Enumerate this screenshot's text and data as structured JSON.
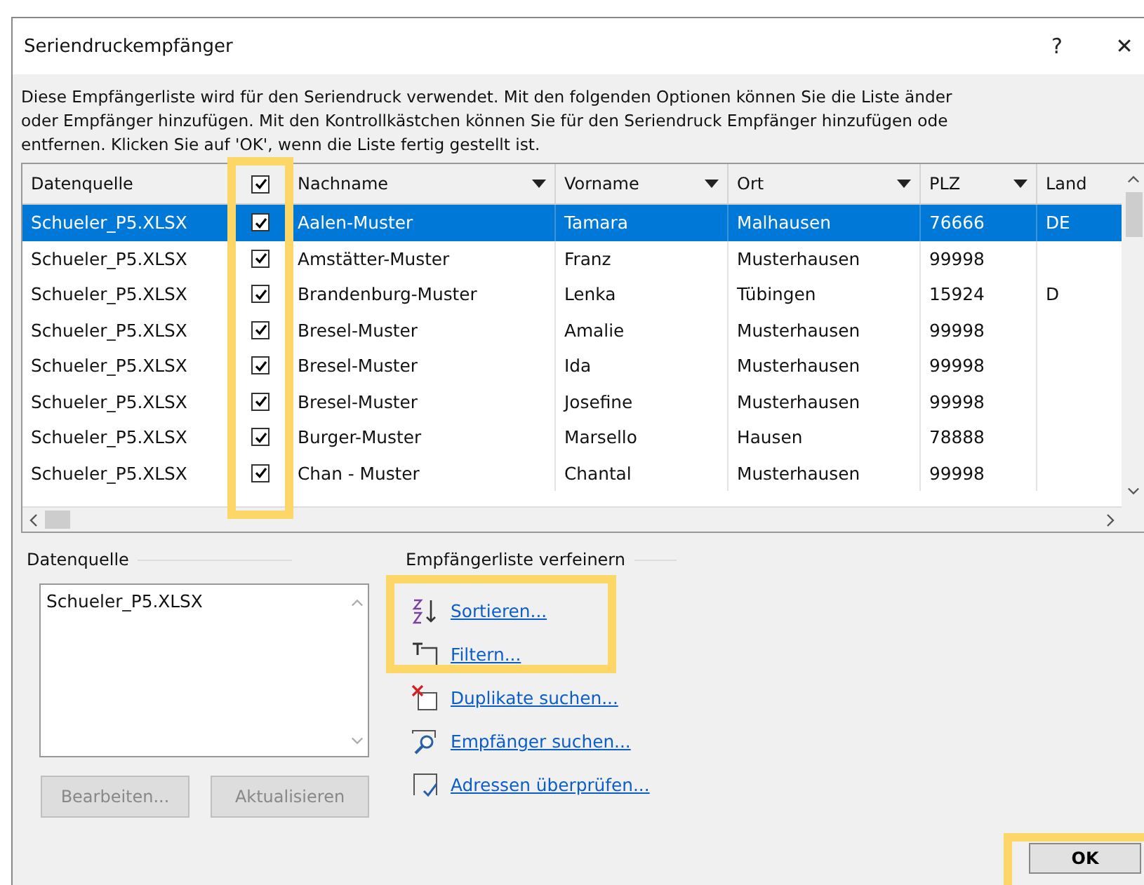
{
  "window": {
    "title": "Seriendruckempfänger",
    "help": "?",
    "close": "✕"
  },
  "intro": [
    "Diese Empfängerliste wird für den Seriendruck verwendet. Mit den folgenden Optionen können Sie die Liste änder",
    "oder Empfänger hinzufügen. Mit den Kontrollkästchen können Sie für den Seriendruck Empfänger hinzufügen ode",
    "entfernen. Klicken Sie auf 'OK', wenn die Liste fertig gestellt ist."
  ],
  "table": {
    "select_all_checked": true,
    "columns": [
      {
        "label": "Datenquelle",
        "kind": "plain"
      },
      {
        "label": "Nachname",
        "kind": "dropdown"
      },
      {
        "label": "Vorname",
        "kind": "dropdown"
      },
      {
        "label": "Ort",
        "kind": "dropdown"
      },
      {
        "label": "PLZ",
        "kind": "dropdown"
      },
      {
        "label": "Land",
        "kind": "plain"
      }
    ],
    "rows": [
      {
        "checked": true,
        "cells": [
          "Schueler_P5.XLSX",
          "Aalen-Muster",
          "Tamara",
          "Malhausen",
          "76666",
          "DE"
        ],
        "selected": true
      },
      {
        "checked": true,
        "cells": [
          "Schueler_P5.XLSX",
          "Amstätter-Muster",
          "Franz",
          "Musterhausen",
          "99998",
          ""
        ],
        "selected": false
      },
      {
        "checked": true,
        "cells": [
          "Schueler_P5.XLSX",
          "Brandenburg-Muster",
          "Lenka",
          "Tübingen",
          "15924",
          "D"
        ],
        "selected": false
      },
      {
        "checked": true,
        "cells": [
          "Schueler_P5.XLSX",
          "Bresel-Muster",
          "Amalie",
          "Musterhausen",
          "99998",
          ""
        ],
        "selected": false
      },
      {
        "checked": true,
        "cells": [
          "Schueler_P5.XLSX",
          "Bresel-Muster",
          "Ida",
          "Musterhausen",
          "99998",
          ""
        ],
        "selected": false
      },
      {
        "checked": true,
        "cells": [
          "Schueler_P5.XLSX",
          "Bresel-Muster",
          "Josefine",
          "Musterhausen",
          "99998",
          ""
        ],
        "selected": false
      },
      {
        "checked": true,
        "cells": [
          "Schueler_P5.XLSX",
          "Burger-Muster",
          "Marsello",
          "Hausen",
          "78888",
          ""
        ],
        "selected": false
      },
      {
        "checked": true,
        "cells": [
          "Schueler_P5.XLSX",
          "Chan - Muster",
          "Chantal",
          "Musterhausen",
          "99998",
          ""
        ],
        "selected": false
      }
    ]
  },
  "datasource": {
    "label": "Datenquelle",
    "items": [
      "Schueler_P5.XLSX"
    ],
    "buttons": [
      {
        "label": "Bearbeiten...",
        "disabled": true
      },
      {
        "label": "Aktualisieren",
        "disabled": true
      }
    ]
  },
  "refine": {
    "label": "Empfängerliste verfeinern",
    "links": [
      {
        "label": "Sortieren...",
        "kind": "sort"
      },
      {
        "label": "Filtern...",
        "kind": "filter"
      },
      {
        "label": "Duplikate suchen...",
        "kind": "duplicates"
      },
      {
        "label": "Empfänger suchen...",
        "kind": "find"
      },
      {
        "label": "Adressen überprüfen...",
        "kind": "validate"
      }
    ]
  },
  "ok_button": "OK"
}
